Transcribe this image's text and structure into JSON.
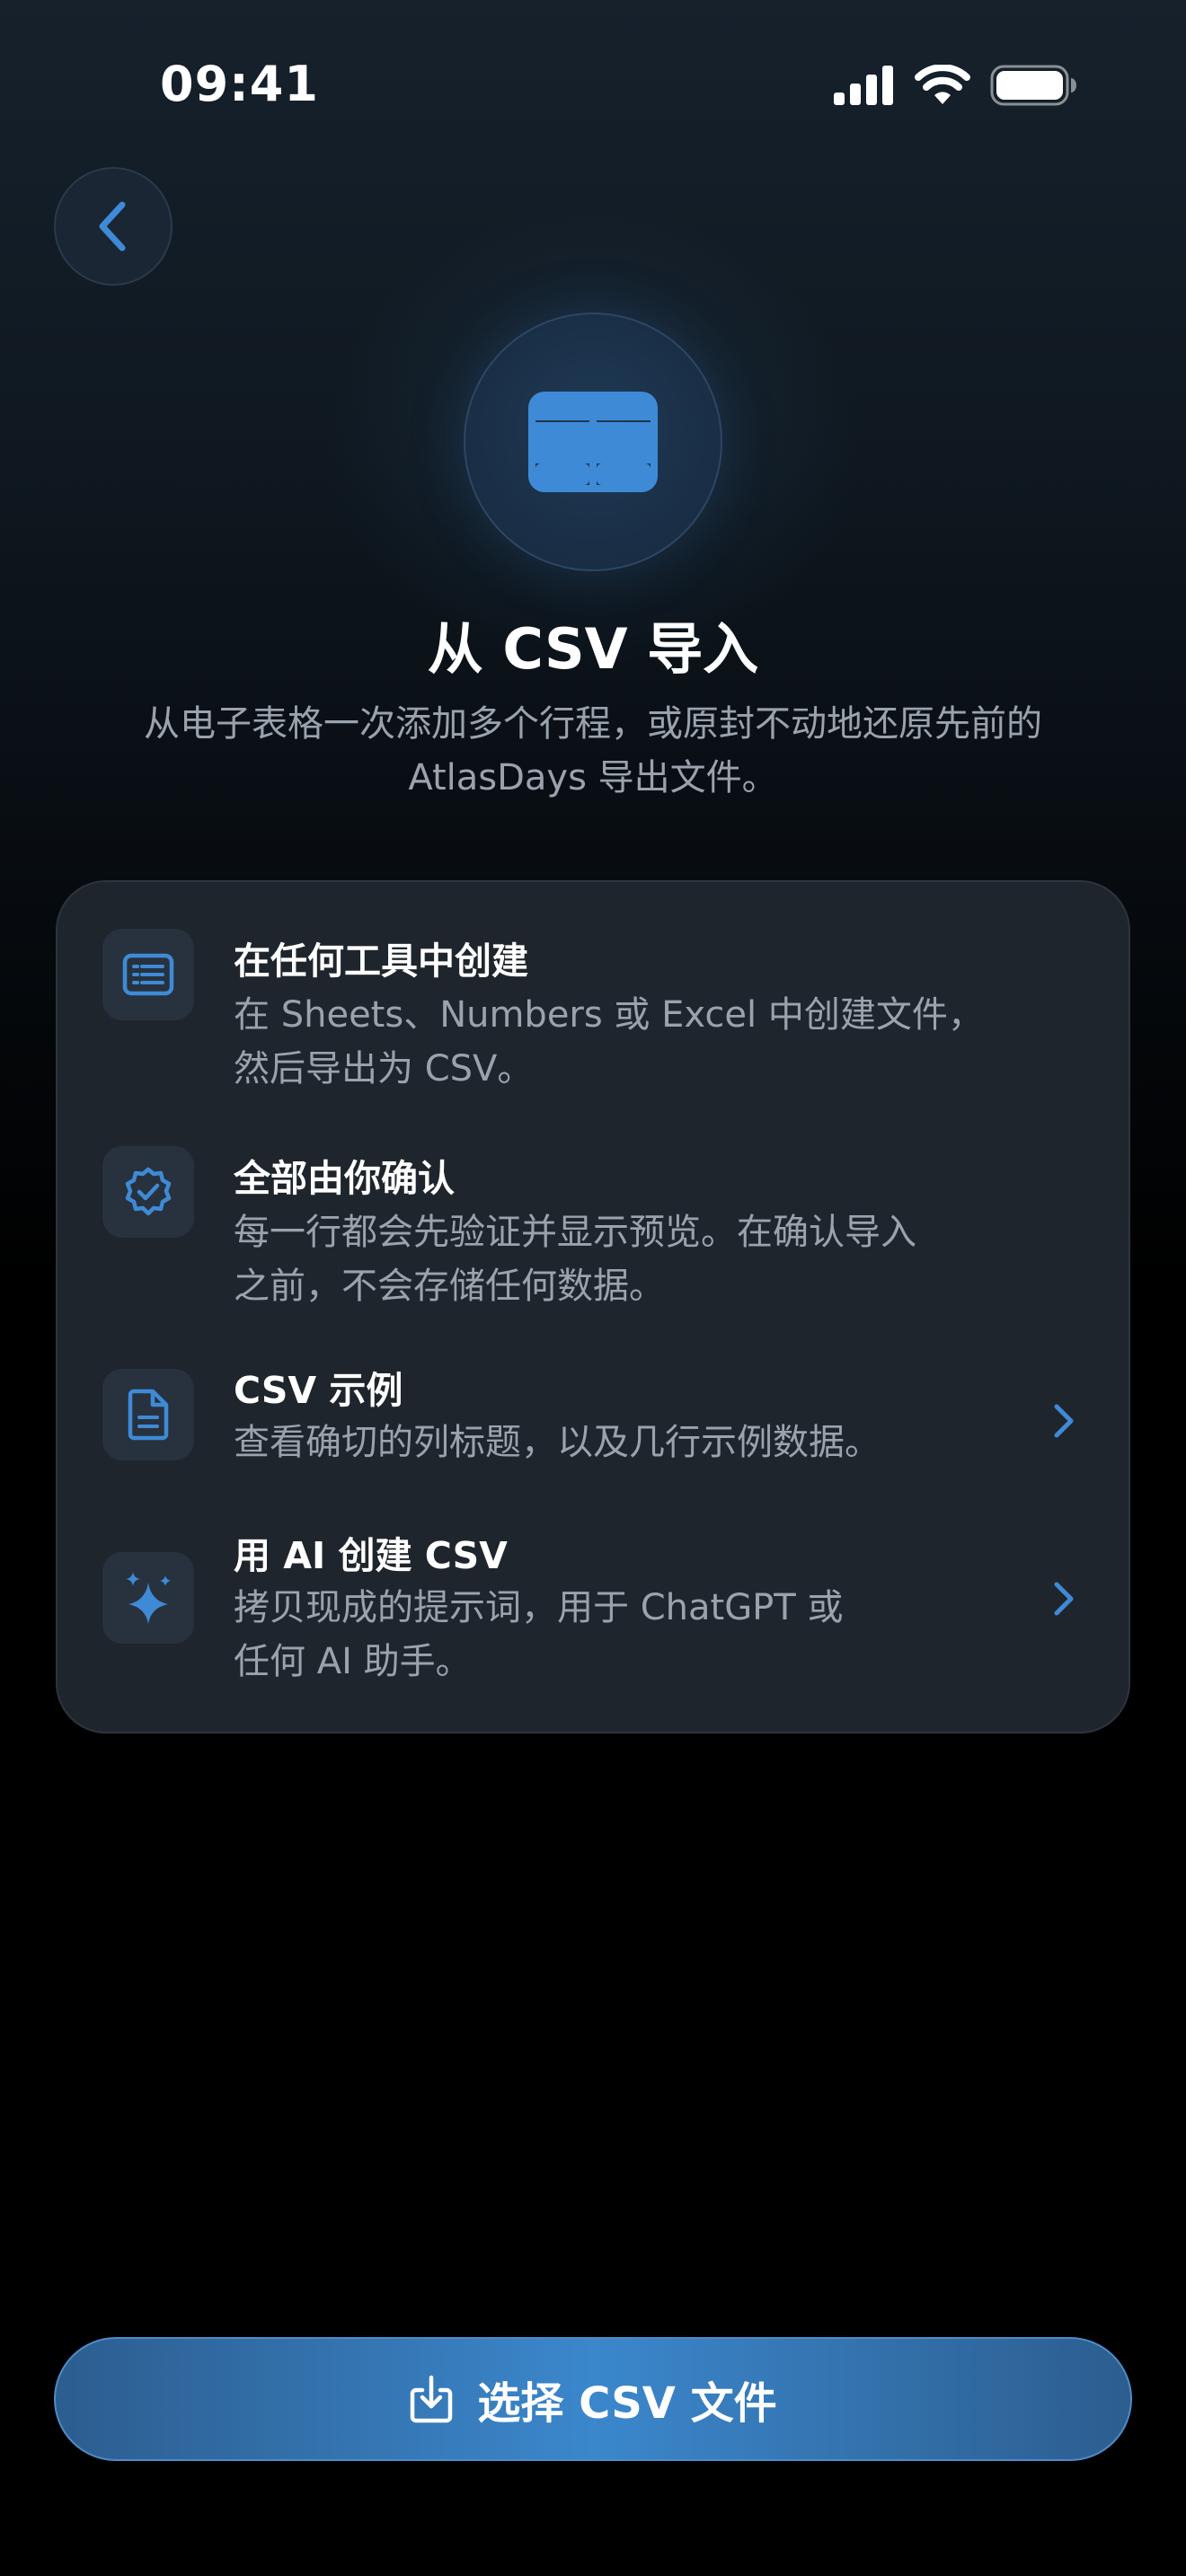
{
  "status_bar": {
    "time": "09:41"
  },
  "header": {
    "title": "从 CSV 导入",
    "subtitle": "从电子表格一次添加多个行程，或原封不动地还原先前的 AtlasDays 导出文件。"
  },
  "features": [
    {
      "icon": "list-document-icon",
      "title": "在任何工具中创建",
      "description": "在 Sheets、Numbers 或 Excel 中创建文件，\n然后导出为 CSV。",
      "has_chevron": false
    },
    {
      "icon": "checkmark-seal-icon",
      "title": "全部由你确认",
      "description": "每一行都会先验证并显示预览。在确认导入\n之前，不会存储任何数据。",
      "has_chevron": false
    },
    {
      "icon": "document-icon",
      "title": "CSV 示例",
      "description": "查看确切的列标题，以及几行示例数据。",
      "has_chevron": true
    },
    {
      "icon": "sparkles-icon",
      "title": "用 AI 创建 CSV",
      "description": "拷贝现成的提示词，用于 ChatGPT 或\n任何 AI 助手。",
      "has_chevron": true
    }
  ],
  "primary_action": {
    "icon": "import-icon",
    "label": "选择 CSV 文件"
  },
  "colors": {
    "accent": "#3b87cc",
    "card_background": "#1f252c",
    "secondary_text": "#9aa3ad"
  }
}
